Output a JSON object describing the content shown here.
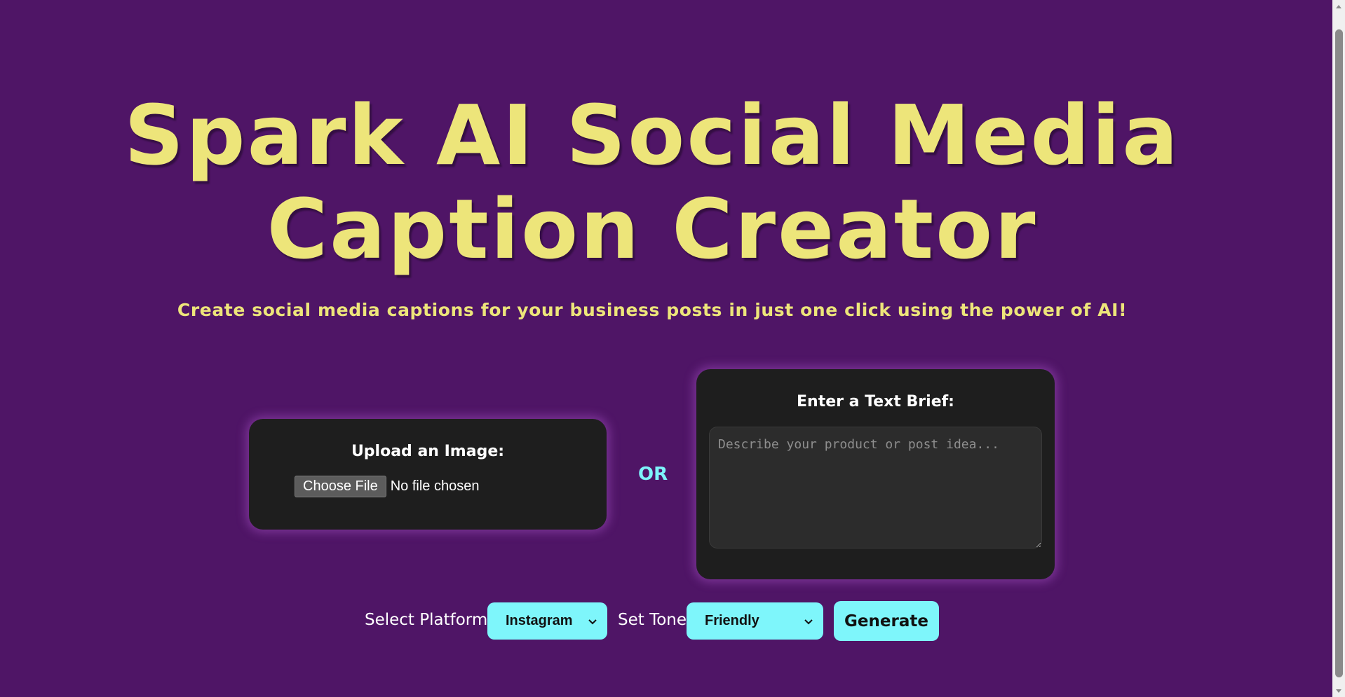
{
  "header": {
    "title": "Spark AI Social Media Caption Creator",
    "subtitle": "Create social media captions for your business posts in just one click using the power of AI!"
  },
  "upload_card": {
    "heading": "Upload an Image:",
    "choose_file_label": "Choose File",
    "file_status": "No file chosen"
  },
  "separator": {
    "label": "OR"
  },
  "brief_card": {
    "heading": "Enter a Text Brief:",
    "placeholder": "Describe your product or post idea...",
    "value": ""
  },
  "controls": {
    "platform_label": "Select Platform:",
    "platform_selected": "Instagram",
    "tone_label": "Set Tone:",
    "tone_selected": "Friendly",
    "generate_label": "Generate"
  },
  "icons": {
    "select_arrow": "chevron-down-icon",
    "scroll_up": "arrow-up-icon",
    "scroll_down": "arrow-down-icon"
  },
  "colors": {
    "background": "#4f1566",
    "title_yellow": "#ede57a",
    "card_dark": "#1e1e1e",
    "accent_cyan": "#7ef6fb",
    "or_cyan": "#7ef4fb"
  }
}
